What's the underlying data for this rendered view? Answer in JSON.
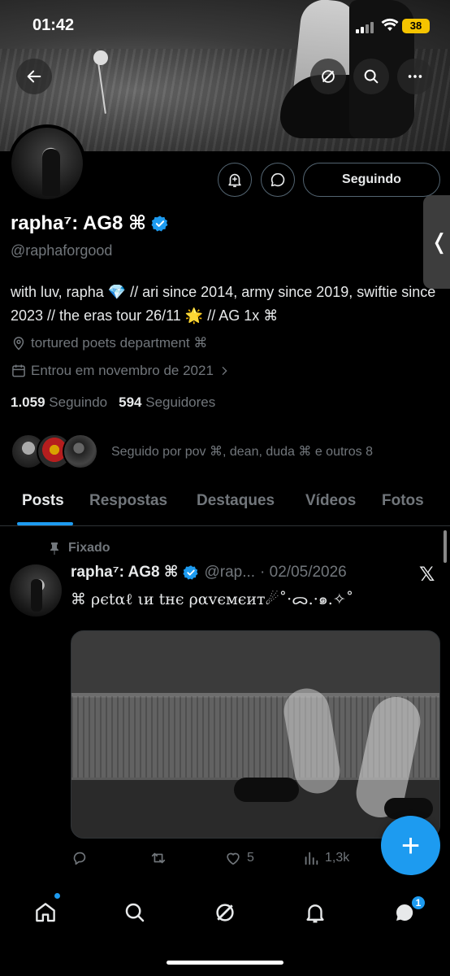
{
  "status_bar": {
    "time": "01:42",
    "battery": "38"
  },
  "profile": {
    "name": "rapha⁷: AG8 ⌘",
    "handle": "@raphaforgood",
    "bio": "with luv, rapha 💎 // ari since 2014, army since 2019, swiftie since 2023 // the eras tour 26/11 🌟 // AG 1x ⌘",
    "location": "tortured poets department ⌘",
    "joined": "Entrou em novembro de 2021",
    "following_count": "1.059",
    "following_label": "Seguindo",
    "followers_count": "594",
    "followers_label": "Seguidores",
    "followed_by": "Seguido por pov ⌘, dean, duda ⌘ e outros 8",
    "follow_button": "Seguindo"
  },
  "tabs": [
    "Posts",
    "Respostas",
    "Destaques",
    "Vídeos",
    "Fotos"
  ],
  "post": {
    "pinned_label": "Fixado",
    "author": "rapha⁷: AG8 ⌘",
    "handle": "@rap...",
    "date": "· 02/05/2026",
    "text": "⌘ ρєtαℓ ιи tнє ραvємєит☄︎˚·ᯅ.·๑.✧˚",
    "likes": "5",
    "views": "1,3k"
  },
  "notifications_badge": "1",
  "colors": {
    "accent": "#1d9bf0",
    "background": "#000000",
    "muted": "#71767b",
    "battery": "#f5c400"
  },
  "icons": [
    "back-arrow-icon",
    "grok-icon",
    "search-icon",
    "more-icon",
    "notification-bell-icon",
    "message-icon",
    "location-icon",
    "calendar-icon",
    "pin-icon",
    "x-logo-icon",
    "reply-icon",
    "repost-icon",
    "like-icon",
    "views-icon",
    "compose-icon",
    "home-icon",
    "messages-icon"
  ]
}
